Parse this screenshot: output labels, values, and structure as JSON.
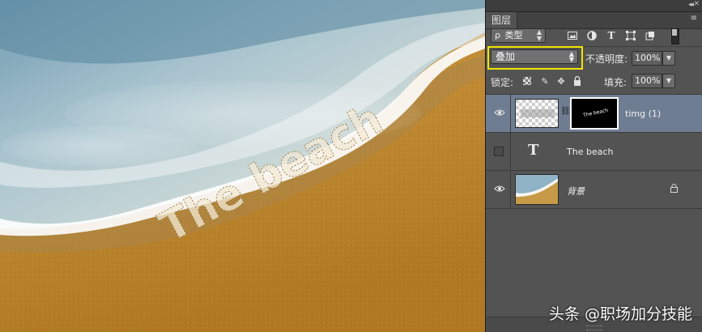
{
  "panel": {
    "collapse_glyph": "◂◂",
    "close_glyph": "✕",
    "tab_label": "图层",
    "menu_glyph": "≡",
    "filter": {
      "search_glyph": "ρ",
      "kind_label": "类型",
      "icons": [
        "image-filter-icon",
        "adjustment-filter-icon",
        "text-filter-icon",
        "shape-filter-icon",
        "smart-object-filter-icon"
      ]
    },
    "blend_mode": "叠加",
    "opacity_label": "不透明度:",
    "opacity_value": "100%",
    "lock_label": "锁定:",
    "fill_label": "填充:",
    "fill_value": "100%"
  },
  "layers": [
    {
      "name": "timg (1)",
      "visible": true,
      "selected": true,
      "mask_text": "The beach"
    },
    {
      "name": "The beach",
      "visible": false,
      "selected": false,
      "type_glyph": "T"
    },
    {
      "name": "背景",
      "visible": true,
      "selected": false,
      "locked": true
    }
  ],
  "canvas": {
    "text": "The beach"
  },
  "watermark": "头条 @职场加分技能",
  "colors": {
    "highlight": "#f2e400",
    "selected_layer": "#6f7d92",
    "panel_bg": "#535353"
  }
}
